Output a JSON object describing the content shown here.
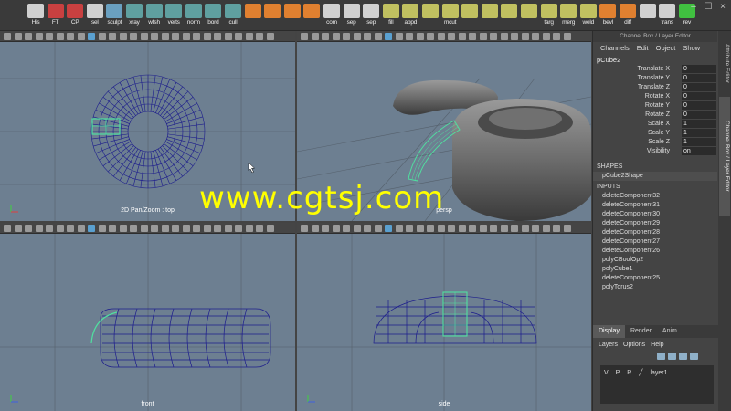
{
  "shelf": {
    "items": [
      {
        "label": "His",
        "icon": "history-icon",
        "color": "#d0d0d0"
      },
      {
        "label": "FT",
        "icon": "freeze-transform-icon",
        "color": "#c84040"
      },
      {
        "label": "CP",
        "icon": "center-pivot-icon",
        "color": "#c84040"
      },
      {
        "label": "sel",
        "icon": "select-icon",
        "color": "#d0d0d0"
      },
      {
        "label": "sculpt",
        "icon": "sculpt-icon",
        "color": "#6aa0c0"
      },
      {
        "label": "xray",
        "icon": "xray-icon",
        "color": "#5fa0a0"
      },
      {
        "label": "wfsh",
        "icon": "wireframe-shaded-icon",
        "color": "#5fa0a0"
      },
      {
        "label": "verts",
        "icon": "vertices-icon",
        "color": "#5fa0a0"
      },
      {
        "label": "norm",
        "icon": "normals-icon",
        "color": "#5fa0a0"
      },
      {
        "label": "bord",
        "icon": "border-edges-icon",
        "color": "#5fa0a0"
      },
      {
        "label": "cull",
        "icon": "backface-cull-icon",
        "color": "#5fa0a0"
      },
      {
        "label": "",
        "icon": "poly-sphere-icon",
        "color": "#e08030"
      },
      {
        "label": "",
        "icon": "poly-cube-icon",
        "color": "#e08030"
      },
      {
        "label": "",
        "icon": "poly-cylinder-icon",
        "color": "#e08030"
      },
      {
        "label": "",
        "icon": "poly-plane-icon",
        "color": "#e08030"
      },
      {
        "label": "com",
        "icon": "combine-icon",
        "color": "#d0d0d0"
      },
      {
        "label": "sep",
        "icon": "separate-icon",
        "color": "#d0d0d0"
      },
      {
        "label": "sep",
        "icon": "extract-icon",
        "color": "#d0d0d0"
      },
      {
        "label": "fill",
        "icon": "fill-hole-icon",
        "color": "#c0c060"
      },
      {
        "label": "appd",
        "icon": "append-polygon-icon",
        "color": "#c0c060"
      },
      {
        "label": "",
        "icon": "split-icon",
        "color": "#c0c060"
      },
      {
        "label": "mcut",
        "icon": "multi-cut-icon",
        "color": "#c0c060"
      },
      {
        "label": "",
        "icon": "insert-edge-loop-icon",
        "color": "#c0c060"
      },
      {
        "label": "",
        "icon": "offset-edge-loop-icon",
        "color": "#c0c060"
      },
      {
        "label": "",
        "icon": "extrude-icon",
        "color": "#c0c060"
      },
      {
        "label": "",
        "icon": "bridge-icon",
        "color": "#c0c060"
      },
      {
        "label": "targ",
        "icon": "target-weld-icon",
        "color": "#c0c060"
      },
      {
        "label": "merg",
        "icon": "merge-icon",
        "color": "#c0c060"
      },
      {
        "label": "weld",
        "icon": "weld-icon",
        "color": "#c0c060"
      },
      {
        "label": "bevl",
        "icon": "bevel-icon",
        "color": "#e08030"
      },
      {
        "label": "diff",
        "icon": "boolean-difference-icon",
        "color": "#e08030"
      },
      {
        "label": "",
        "icon": "planar-uv-icon",
        "color": "#d0d0d0"
      },
      {
        "label": "trans",
        "icon": "transfer-icon",
        "color": "#d0d0d0"
      },
      {
        "label": "rev",
        "icon": "reverse-icon",
        "color": "#40c040"
      }
    ],
    "window_controls": [
      "–",
      "☐",
      "×"
    ]
  },
  "viewports": {
    "top": {
      "label": "2D Pan/Zoom : top"
    },
    "persp": {
      "label": "persp"
    },
    "front": {
      "label": "front"
    },
    "side": {
      "label": "side"
    }
  },
  "channel_box": {
    "title": "Channel Box / Layer Editor",
    "menu": [
      "Channels",
      "Edit",
      "Object",
      "Show"
    ],
    "object_name": "pCube2",
    "attributes": [
      {
        "name": "Translate X",
        "value": "0"
      },
      {
        "name": "Translate Y",
        "value": "0"
      },
      {
        "name": "Translate Z",
        "value": "0"
      },
      {
        "name": "Rotate X",
        "value": "0"
      },
      {
        "name": "Rotate Y",
        "value": "0"
      },
      {
        "name": "Rotate Z",
        "value": "0"
      },
      {
        "name": "Scale X",
        "value": "1"
      },
      {
        "name": "Scale Y",
        "value": "1"
      },
      {
        "name": "Scale Z",
        "value": "1"
      },
      {
        "name": "Visibility",
        "value": "on"
      }
    ],
    "shapes_header": "SHAPES",
    "shapes": [
      "pCube2Shape"
    ],
    "inputs_header": "INPUTS",
    "inputs": [
      "deleteComponent32",
      "deleteComponent31",
      "deleteComponent30",
      "deleteComponent29",
      "deleteComponent28",
      "deleteComponent27",
      "deleteComponent26",
      "polyCBoolOp2",
      "polyCube1",
      "deleteComponent25",
      "polyTorus2"
    ]
  },
  "layer_editor": {
    "tabs": [
      "Display",
      "Render",
      "Anim"
    ],
    "active_tab": "Display",
    "menu": [
      "Layers",
      "Options",
      "Help"
    ],
    "layer": {
      "v": "V",
      "p": "P",
      "r": "R",
      "name": "layer1"
    }
  },
  "side_tabs": [
    "Attribute Editor",
    "Channel Box / Layer Editor"
  ],
  "watermark": "www.cgtsj.com",
  "colors": {
    "viewport_bg": "#6d7f91",
    "wireframe": "#1c1c8c",
    "selection": "#50e0a0",
    "watermark": "#ffff00"
  }
}
